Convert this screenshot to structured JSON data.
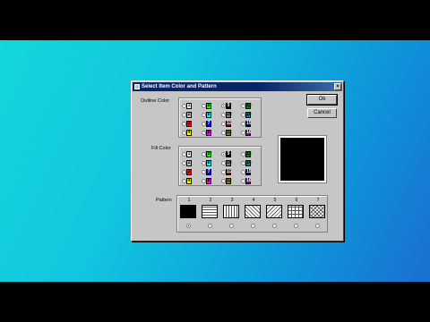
{
  "dialog": {
    "title": "Select Item Color and Pattern",
    "close_label": "×",
    "ok_label": "Ok",
    "cancel_label": "Cancel",
    "outline_label": "Outline Color",
    "fill_label": "Fill Color",
    "pattern_label": "Pattern"
  },
  "colors": [
    {
      "num": "1",
      "bg": "#ffffff",
      "fg": "#000000"
    },
    {
      "num": "2",
      "bg": "#c0c0c0",
      "fg": "#000000"
    },
    {
      "num": "3",
      "bg": "#ff0000",
      "fg": "#000000"
    },
    {
      "num": "4",
      "bg": "#ffff00",
      "fg": "#000000"
    },
    {
      "num": "5",
      "bg": "#00ff00",
      "fg": "#000000"
    },
    {
      "num": "6",
      "bg": "#00ffff",
      "fg": "#000000"
    },
    {
      "num": "7",
      "bg": "#0000ff",
      "fg": "#ffffff"
    },
    {
      "num": "8",
      "bg": "#ff00ff",
      "fg": "#000000"
    },
    {
      "num": "9",
      "bg": "#000000",
      "fg": "#ffffff"
    },
    {
      "num": "10",
      "bg": "#808080",
      "fg": "#000000"
    },
    {
      "num": "11",
      "bg": "#800000",
      "fg": "#ffffff"
    },
    {
      "num": "12",
      "bg": "#808000",
      "fg": "#000000"
    },
    {
      "num": "13",
      "bg": "#008000",
      "fg": "#000000"
    },
    {
      "num": "14",
      "bg": "#008080",
      "fg": "#000000"
    },
    {
      "num": "15",
      "bg": "#000080",
      "fg": "#ffffff"
    },
    {
      "num": "16",
      "bg": "#800080",
      "fg": "#ffffff"
    }
  ],
  "outline_selected": "9",
  "fill_selected": "9",
  "patterns": [
    {
      "num": "1",
      "name": "solid"
    },
    {
      "num": "2",
      "name": "horizontal"
    },
    {
      "num": "3",
      "name": "vertical"
    },
    {
      "num": "4",
      "name": "diagonal-down"
    },
    {
      "num": "5",
      "name": "diagonal-up"
    },
    {
      "num": "6",
      "name": "cross"
    },
    {
      "num": "7",
      "name": "diagonal-cross"
    }
  ],
  "pattern_selected": "1"
}
